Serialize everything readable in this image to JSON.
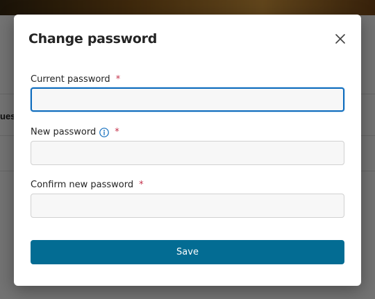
{
  "background": {
    "partial_text": "ues"
  },
  "dialog": {
    "title": "Change password",
    "close_icon": "close-icon",
    "fields": [
      {
        "label": "Current password",
        "required_mark": "*",
        "value": "",
        "placeholder": "",
        "focused": true
      },
      {
        "label": "New password",
        "required_mark": "*",
        "value": "",
        "placeholder": "",
        "info_icon": "info-icon"
      },
      {
        "label": "Confirm new password",
        "required_mark": "*",
        "value": "",
        "placeholder": ""
      }
    ],
    "save_label": "Save"
  },
  "colors": {
    "primary_button": "#036c93",
    "required": "#c4314b",
    "focus_border": "#0f6cbd",
    "info_icon": "#0f6cbd"
  }
}
